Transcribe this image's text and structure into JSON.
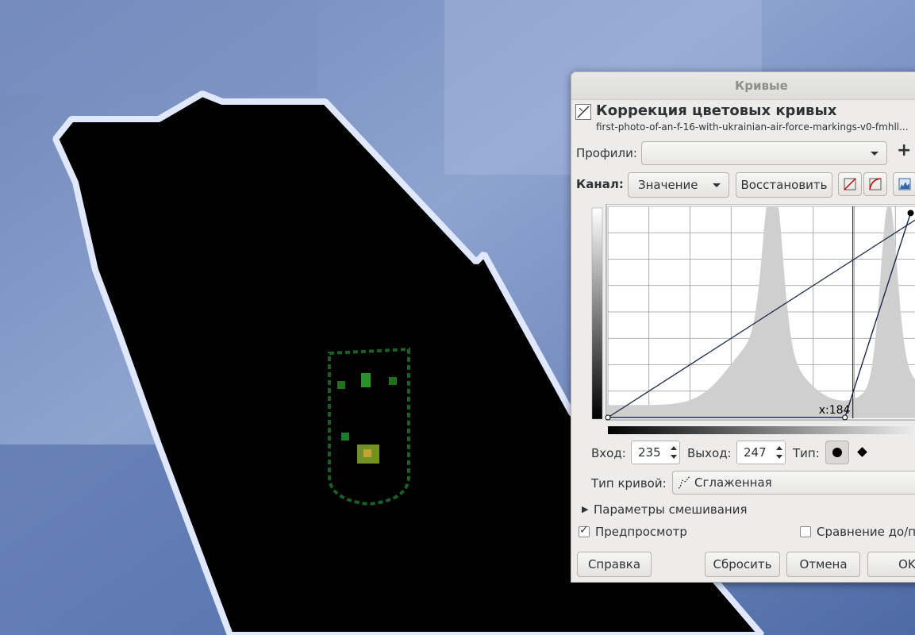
{
  "dialog": {
    "window_title": "Кривые",
    "header_title": "Коррекция цветовых кривых",
    "header_subtitle": "first-photo-of-an-f-16-with-ukrainian-air-force-markings-v0-fmhll...",
    "presets_label": "Профили:",
    "presets_value": "",
    "add_preset_symbol": "+",
    "channel_label": "Канал:",
    "channel_value": "Значение",
    "reset_channel_label": "Восстановить",
    "cursor_readout": "x:184",
    "input_label": "Вход:",
    "input_value": "235",
    "output_label": "Выход:",
    "output_value": "247",
    "type_label": "Тип:",
    "curve_type_label": "Тип кривой:",
    "curve_type_value": "Сглаженная",
    "blending_label": "Параметры смешивания",
    "preview_label": "Предпросмотр",
    "preview_checked": true,
    "split_view_label": "Сравнение до/по",
    "split_view_checked": false,
    "help_label": "Справка",
    "reset_label": "Сбросить",
    "cancel_label": "Отмена",
    "ok_label": "OK"
  },
  "curve_points": [
    [
      0,
      0
    ],
    [
      184,
      0
    ],
    [
      235,
      247
    ]
  ],
  "colors": {
    "curve": "#1d2a4a",
    "histogram": "#cfcfcf",
    "dialog_bg": "#edeceb"
  }
}
